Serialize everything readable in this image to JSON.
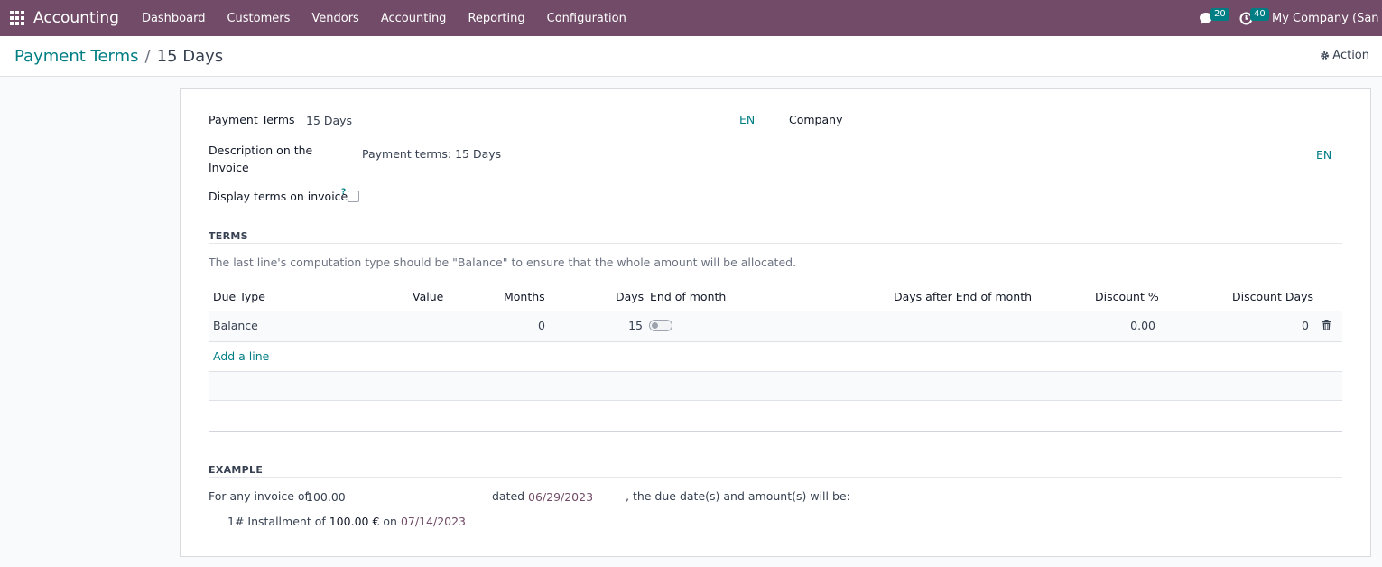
{
  "navbar": {
    "app_name": "Accounting",
    "menu": [
      "Dashboard",
      "Customers",
      "Vendors",
      "Accounting",
      "Reporting",
      "Configuration"
    ],
    "messages_count": "20",
    "activities_count": "40",
    "company": "My Company (San Francisco)"
  },
  "breadcrumb": {
    "parent": "Payment Terms",
    "separator": "/",
    "current": "15 Days"
  },
  "action_label": "Action",
  "form": {
    "payment_terms_label": "Payment Terms",
    "payment_terms_value": "15 Days",
    "lang_code": "EN",
    "company_label": "Company",
    "description_label_1": "Description on the",
    "description_label_2": "Invoice",
    "description_value": "Payment terms: 15 Days",
    "display_terms_label": "Display terms on invoice",
    "help_mark": "?"
  },
  "terms": {
    "section_title": "TERMS",
    "note": "The last line's computation type should be \"Balance\" to ensure that the whole amount will be allocated.",
    "columns": {
      "due_type": "Due Type",
      "value": "Value",
      "months": "Months",
      "days": "Days",
      "end_of_month": "End of month",
      "days_after_eom": "Days after End of month",
      "discount_pct": "Discount %",
      "discount_days": "Discount Days"
    },
    "rows": [
      {
        "due_type": "Balance",
        "value": "",
        "months": "0",
        "days": "15",
        "end_of_month": false,
        "days_after_eom": "",
        "discount_pct": "0.00",
        "discount_days": "0"
      }
    ],
    "add_line": "Add a line"
  },
  "example": {
    "section_title": "EXAMPLE",
    "prefix": "For any invoice of",
    "amount": "100.00",
    "dated_label": "dated",
    "date": "06/29/2023",
    "suffix": ", the due date(s) and amount(s) will be:",
    "installment_prefix": "1# Installment of",
    "installment_amount": "100.00 €",
    "installment_on": "on",
    "installment_date": "07/14/2023"
  },
  "colors": {
    "brand": "#714b67",
    "accent": "#017e84"
  }
}
